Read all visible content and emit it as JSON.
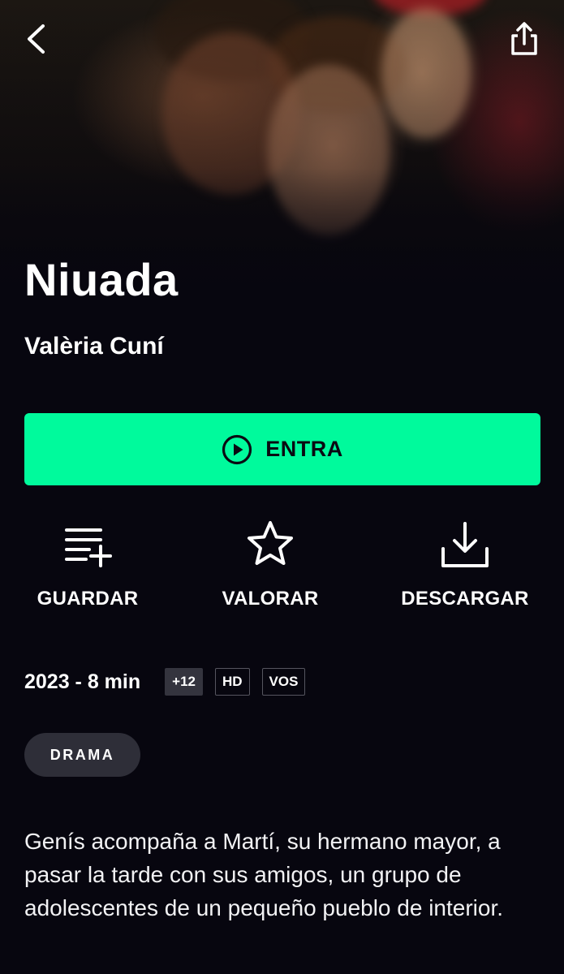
{
  "topbar": {
    "back_icon": "chevron-left-icon",
    "share_icon": "share-icon"
  },
  "title": "Niuada",
  "director": "Valèria Cuní",
  "play": {
    "label": "ENTRA",
    "icon": "play-circle-icon",
    "color": "#00fa9c"
  },
  "actions": [
    {
      "label": "GUARDAR",
      "icon": "playlist-add-icon"
    },
    {
      "label": "VALORAR",
      "icon": "star-icon"
    },
    {
      "label": "DESCARGAR",
      "icon": "download-icon"
    }
  ],
  "meta": {
    "year_duration": "2023 - 8 min",
    "badges": [
      "+12",
      "HD",
      "VOS"
    ]
  },
  "genre": "DRAMA",
  "synopsis": "Genís acompaña a Martí, su hermano mayor, a pasar la tarde con sus amigos, un grupo de adolescentes de un pequeño pueblo de interior.",
  "colors": {
    "background": "#07060f",
    "accent": "#00fa9c",
    "chip": "#2e2e38"
  }
}
